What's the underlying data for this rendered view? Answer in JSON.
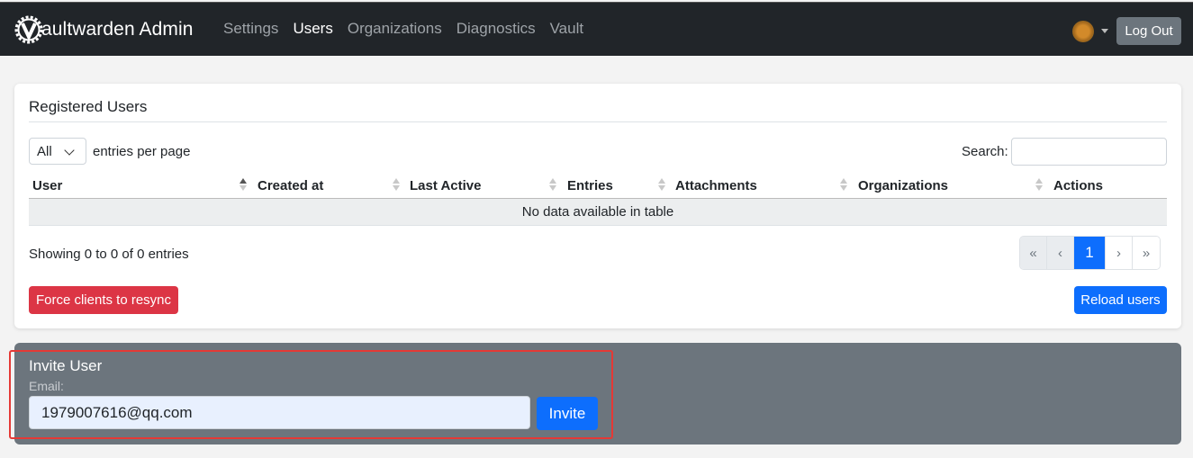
{
  "navbar": {
    "brand": "aultwarden Admin",
    "links": [
      {
        "label": "Settings",
        "active": false
      },
      {
        "label": "Users",
        "active": true
      },
      {
        "label": "Organizations",
        "active": false
      },
      {
        "label": "Diagnostics",
        "active": false
      },
      {
        "label": "Vault",
        "active": false
      }
    ],
    "logout_label": "Log Out"
  },
  "users_card": {
    "title": "Registered Users",
    "length_select_value": "All",
    "length_label": "entries per page",
    "search_label": "Search:",
    "search_value": "",
    "columns": [
      "User",
      "Created at",
      "Last Active",
      "Entries",
      "Attachments",
      "Organizations",
      "Actions"
    ],
    "empty_message": "No data available in table",
    "info": "Showing 0 to 0 of 0 entries",
    "pagination": [
      "«",
      "‹",
      "1",
      "›",
      "»"
    ],
    "current_page": "1",
    "resync_label": "Force clients to resync",
    "reload_label": "Reload users"
  },
  "invite": {
    "title": "Invite User",
    "email_label": "Email:",
    "email_value": "1979007616@qq.com",
    "button_label": "Invite"
  },
  "colors": {
    "navbar_bg": "#212529",
    "primary": "#0d6efd",
    "danger": "#dc3545",
    "secondary": "#6c757d",
    "highlight": "#e53935"
  }
}
